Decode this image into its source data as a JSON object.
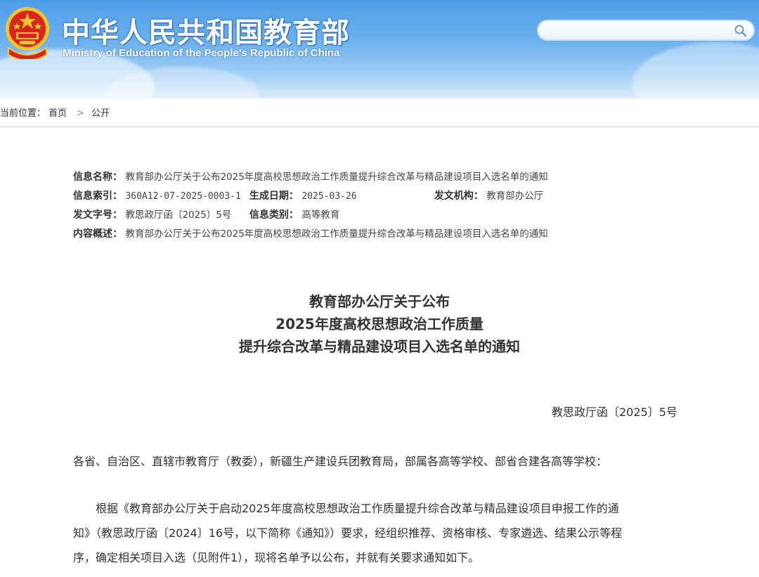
{
  "header": {
    "title_cn": "中华人民共和国教育部",
    "title_en": "Ministry of Education of the People's Republic of China",
    "search_placeholder": ""
  },
  "breadcrumb": {
    "prefix": "当前位置：",
    "home": "首页",
    "separator": ">",
    "current": "公开"
  },
  "meta": {
    "name_label": "信息名称：",
    "name_value": "教育部办公厅关于公布2025年度高校思想政治工作质量提升综合改革与精品建设项目入选名单的通知",
    "index_label": "信息索引：",
    "index_value": "360A12-07-2025-0003-1",
    "date_label": "生成日期：",
    "date_value": "2025-03-26",
    "issuer_label": "发文机构：",
    "issuer_value": "教育部办公厅",
    "docno_label": "发文字号：",
    "docno_value": "教思政厅函〔2025〕5号",
    "category_label": "信息类别：",
    "category_value": "高等教育",
    "summary_label": "内容概述：",
    "summary_value": "教育部办公厅关于公布2025年度高校思想政治工作质量提升综合改革与精品建设项目入选名单的通知"
  },
  "document": {
    "title_line1": "教育部办公厅关于公布",
    "title_line2": "2025年度高校思想政治工作质量",
    "title_line3": "提升综合改革与精品建设项目入选名单的通知",
    "number": "教思政厅函〔2025〕5号",
    "recipients": "各省、自治区、直辖市教育厅（教委），新疆生产建设兵团教育局，部属各高等学校、部省合建各高等学校：",
    "body_line1": "根据《教育部办公厅关于启动2025年度高校思想政治工作质量提升综合改革与精品建设项目申报工作的通",
    "body_line2": "知》（教思政厅函〔2024〕16号，以下简称《通知》）要求，经组织推荐、资格审核、专家遴选、结果公示等程",
    "body_line3": "序，确定相关项目入选（见附件1），现将名单予以公布，并就有关要求通知如下。"
  },
  "colors": {
    "banner_top": "#4f9de8",
    "banner_bottom": "#dcecfb",
    "emblem_red": "#d7261e",
    "emblem_gold": "#f4c430"
  },
  "icons": [
    "national-emblem-icon",
    "search-icon"
  ]
}
